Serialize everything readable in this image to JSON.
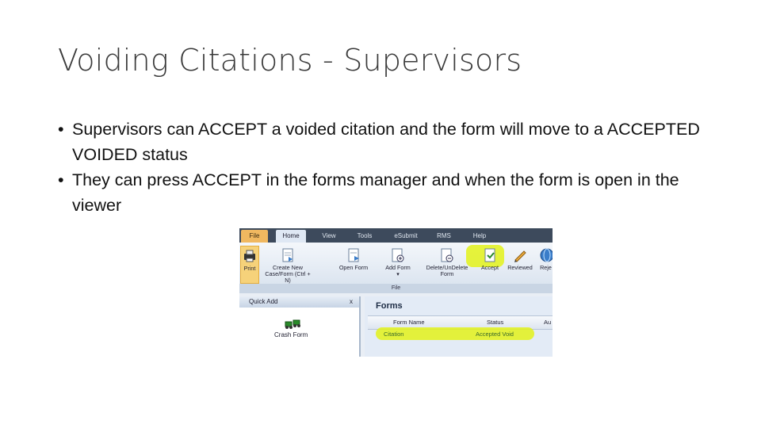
{
  "slide": {
    "title": "Voiding Citations - Supervisors",
    "bullets": [
      "Supervisors can ACCEPT a voided citation and the form will move to a ACCEPTED VOIDED status",
      "They can press ACCEPT in the forms manager and when the form is open in the viewer"
    ]
  },
  "screenshot": {
    "menu_tabs": [
      "File",
      "Home",
      "View",
      "Tools",
      "eSubmit",
      "RMS",
      "Help"
    ],
    "ribbon_buttons": [
      "Print",
      "Create New Case/Form (Ctrl + N)",
      "Open Form",
      "Add Form",
      "Delete/UnDelete Form",
      "Accept",
      "Reviewed",
      "Reje"
    ],
    "ribbon_group_label": "File",
    "quick_add": {
      "title": "Quick Add",
      "close": "x",
      "item": "Crash Form"
    },
    "forms": {
      "title": "Forms",
      "columns": [
        "Form Name",
        "Status",
        "Au"
      ],
      "row": {
        "form_name": "Citation",
        "status": "Accepted Void"
      }
    },
    "colors": {
      "highlight": "#e3f21a",
      "menubar": "#3d4a5c",
      "selected_row": "#4a9ee0"
    }
  }
}
